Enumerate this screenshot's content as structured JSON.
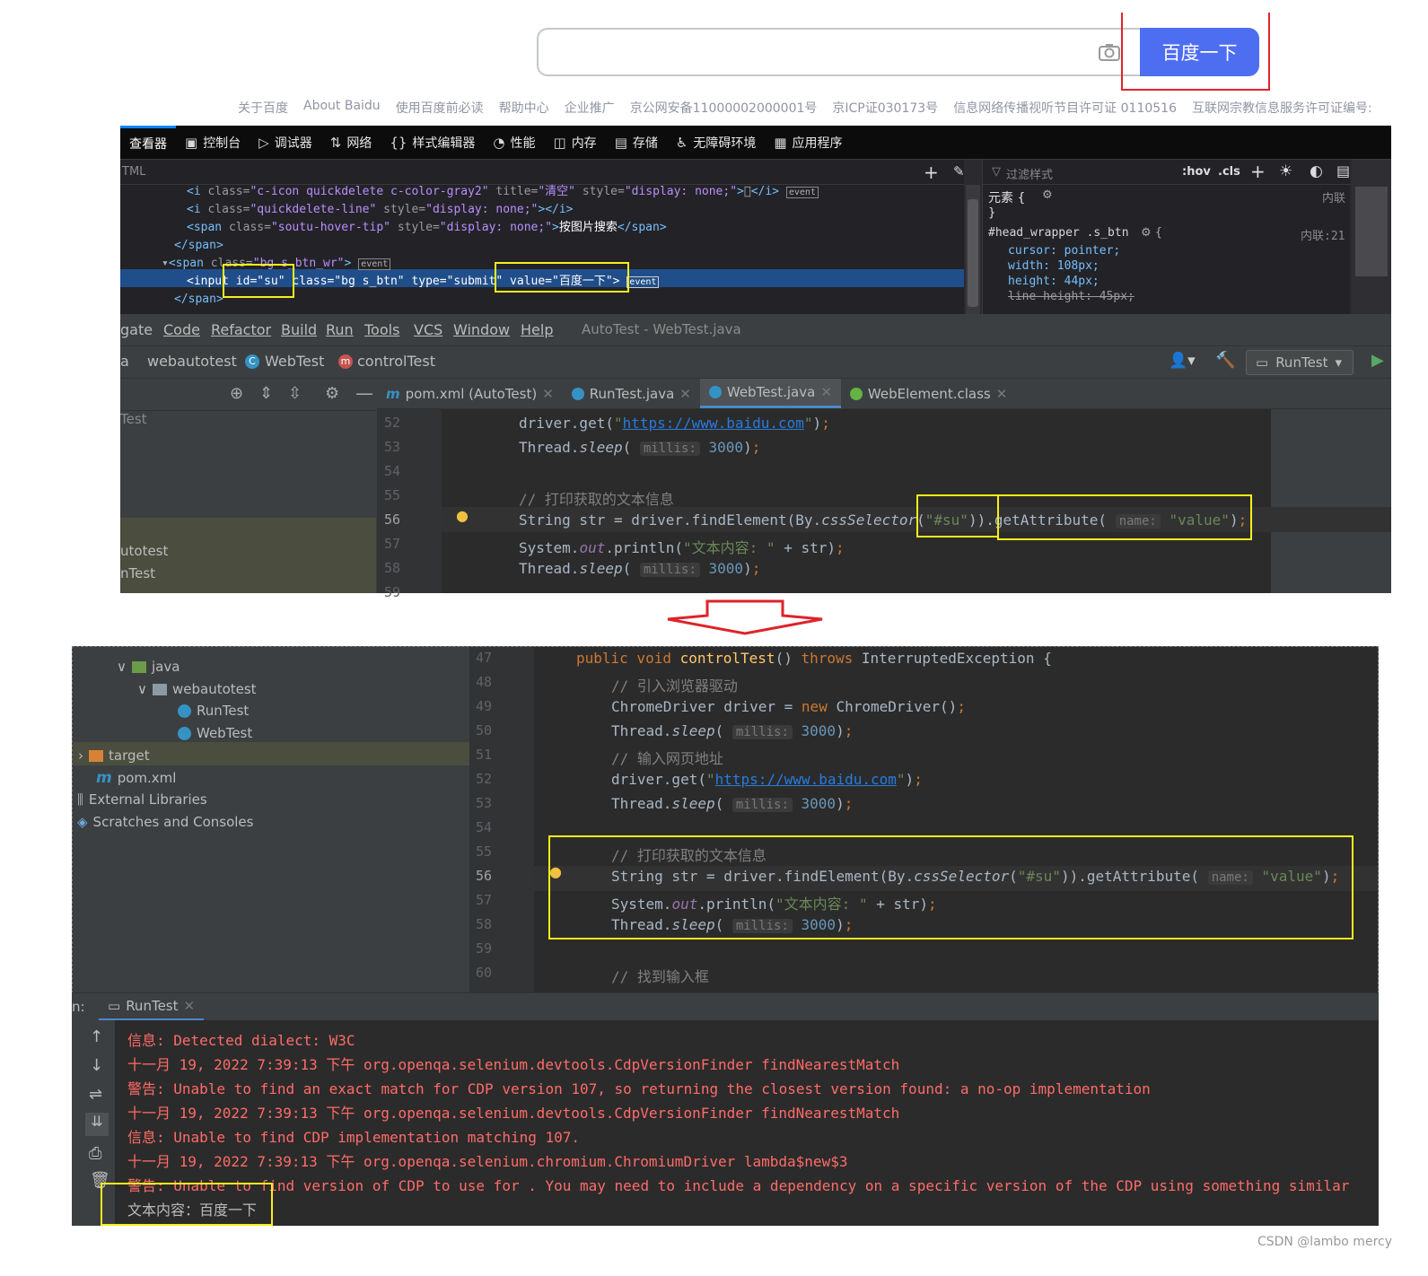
{
  "baidu": {
    "search_button": "百度一下",
    "footer_links": [
      "关于百度",
      "About Baidu",
      "使用百度前必读",
      "帮助中心",
      "企业推广",
      "京公网安备11000002000001号",
      "京ICP证030173号",
      "信息网络传播视听节目许可证 0110516",
      "互联网宗教信息服务许可证编号:"
    ]
  },
  "devtools": {
    "tabs": [
      "查看器",
      "控制台",
      "调试器",
      "网络",
      "样式编辑器",
      "性能",
      "内存",
      "存储",
      "无障碍环境",
      "应用程序"
    ],
    "html_label": "TML",
    "filter_placeholder": "过滤样式",
    "hov": ":hov",
    "cls": ".cls",
    "html_lines": [
      "<i class=\"c-icon quickdelete c-color-gray2\" title=\"清空\" style=\"display: none;\">\u0000</i>",
      "<i class=\"quickdelete-line\" style=\"display: none;\"></i>",
      "<span class=\"soutu-hover-tip\" style=\"display: none;\">按图片搜索</span>",
      "</span>",
      "<span class=\"bg s_btn_wr\">",
      "<input id=\"su\" class=\"bg s_btn\" type=\"submit\" value=\"百度一下\">",
      "</span>"
    ],
    "event_badge": "event",
    "rules": {
      "element": "元素 {",
      "element_src": "内联",
      "close": "}",
      "selector": "#head_wrapper .s_btn",
      "selector_src": "内联:21",
      "props": [
        "cursor: pointer;",
        "width: 108px;",
        "height: 44px;",
        "line-height: 45px;"
      ]
    }
  },
  "ide_top": {
    "menu": [
      "gate",
      "Code",
      "Refactor",
      "Build",
      "Run",
      "Tools",
      "VCS",
      "Window",
      "Help"
    ],
    "title": "AutoTest - WebTest.java",
    "breadcrumb": [
      "a",
      "webautotest",
      "WebTest",
      "controlTest"
    ],
    "run_config": "RunTest",
    "tabs": [
      "pom.xml (AutoTest)",
      "RunTest.java",
      "WebTest.java",
      "WebElement.class"
    ],
    "project_items": [
      "Test",
      "utotest",
      "nTest"
    ],
    "line_numbers": [
      "52",
      "53",
      "54",
      "55",
      "56",
      "57",
      "58",
      "59"
    ]
  },
  "ide_bottom": {
    "tree": [
      "java",
      "webautotest",
      "RunTest",
      "WebTest",
      "target",
      "pom.xml",
      "External Libraries",
      "Scratches and Consoles"
    ],
    "line_numbers": [
      "47",
      "48",
      "49",
      "50",
      "51",
      "52",
      "53",
      "54",
      "55",
      "56",
      "57",
      "58",
      "59",
      "60"
    ],
    "run_label": "n:",
    "run_tab": "RunTest",
    "console": [
      "信息: Detected dialect: W3C",
      "十一月 19, 2022 7:39:13 下午 org.openqa.selenium.devtools.CdpVersionFinder findNearestMatch",
      "警告: Unable to find an exact match for CDP version 107, so returning the closest version found: a no-op implementation",
      "十一月 19, 2022 7:39:13 下午 org.openqa.selenium.devtools.CdpVersionFinder findNearestMatch",
      "信息: Unable to find CDP implementation matching 107.",
      "十一月 19, 2022 7:39:13 下午 org.openqa.selenium.chromium.ChromiumDriver lambda$new$3",
      "警告: Unable to find version of CDP to use for . You may need to include a dependency on a specific version of the CDP using something similar"
    ],
    "output": "文本内容：百度一下"
  },
  "watermark": "CSDN @lambo mercy"
}
